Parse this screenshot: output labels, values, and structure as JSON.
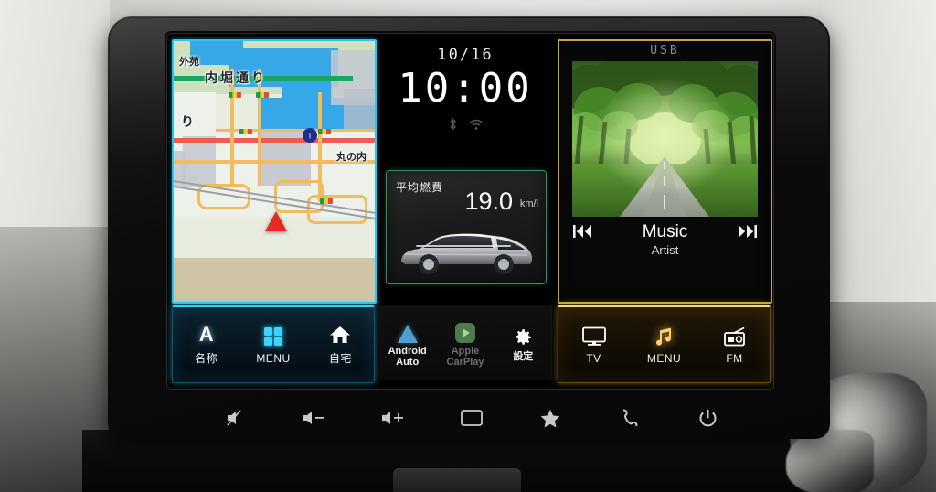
{
  "device": {
    "name": "car-infotainment-head-unit",
    "accents": {
      "nav_cyan": "#2fd2f5",
      "media_gold": "#ffd86a",
      "fuel_green": "#3f8a63",
      "android_blue": "#4f9ed1",
      "carplay_green": "#4f7a4a"
    }
  },
  "nav_panel": {
    "map_labels": [
      {
        "text": "外苑",
        "name": "map-label-gaien"
      },
      {
        "text": "内堀通り",
        "name": "map-label-uchibori-dori"
      },
      {
        "text": "り",
        "name": "map-label-ri"
      },
      {
        "text": "丸の内",
        "name": "map-label-marunouchi"
      }
    ],
    "buttons": [
      {
        "label": "名称",
        "icon": "letter-a-icon",
        "name": "nav-button-name"
      },
      {
        "label": "MENU",
        "icon": "grid-menu-icon",
        "name": "nav-button-menu"
      },
      {
        "label": "自宅",
        "icon": "home-icon",
        "name": "nav-button-home"
      }
    ]
  },
  "center_panel": {
    "clock": {
      "date": "10/16",
      "time": "10:00",
      "status_icons": [
        "bluetooth-icon",
        "wifi-icon"
      ]
    },
    "fuel": {
      "title": "平均燃費",
      "value": "19.0",
      "unit": "km/l"
    },
    "apps": [
      {
        "label": "Android\nAuto",
        "line1": "Android",
        "line2": "Auto",
        "icon": "android-auto-icon",
        "enabled": true,
        "name": "app-android-auto"
      },
      {
        "label": "Apple\nCarPlay",
        "line1": "Apple",
        "line2": "CarPlay",
        "icon": "apple-carplay-icon",
        "enabled": false,
        "name": "app-apple-carplay"
      },
      {
        "label": "設定",
        "line1": "設定",
        "line2": "",
        "icon": "gear-icon",
        "enabled": true,
        "name": "app-settings"
      }
    ]
  },
  "media_panel": {
    "source": "USB",
    "album_art": "tree-lined-road-photo",
    "track_title": "Music",
    "track_artist": "Artist",
    "transport": [
      {
        "icon": "previous-track-icon",
        "name": "media-previous-button"
      },
      {
        "icon": "next-track-icon",
        "name": "media-next-button"
      }
    ],
    "buttons": [
      {
        "label": "TV",
        "icon": "tv-icon",
        "name": "media-button-tv"
      },
      {
        "label": "MENU",
        "icon": "music-note-icon",
        "name": "media-button-menu"
      },
      {
        "label": "FM",
        "icon": "radio-icon",
        "name": "media-button-fm"
      }
    ]
  },
  "hardware_buttons": [
    {
      "icon": "mute-icon",
      "name": "hw-button-mute"
    },
    {
      "icon": "volume-down-icon",
      "name": "hw-button-volume-down"
    },
    {
      "icon": "volume-up-icon",
      "name": "hw-button-volume-up"
    },
    {
      "icon": "display-icon",
      "name": "hw-button-display"
    },
    {
      "icon": "star-icon",
      "name": "hw-button-favorite"
    },
    {
      "icon": "phone-icon",
      "name": "hw-button-phone"
    },
    {
      "icon": "power-icon",
      "name": "hw-button-power"
    }
  ]
}
